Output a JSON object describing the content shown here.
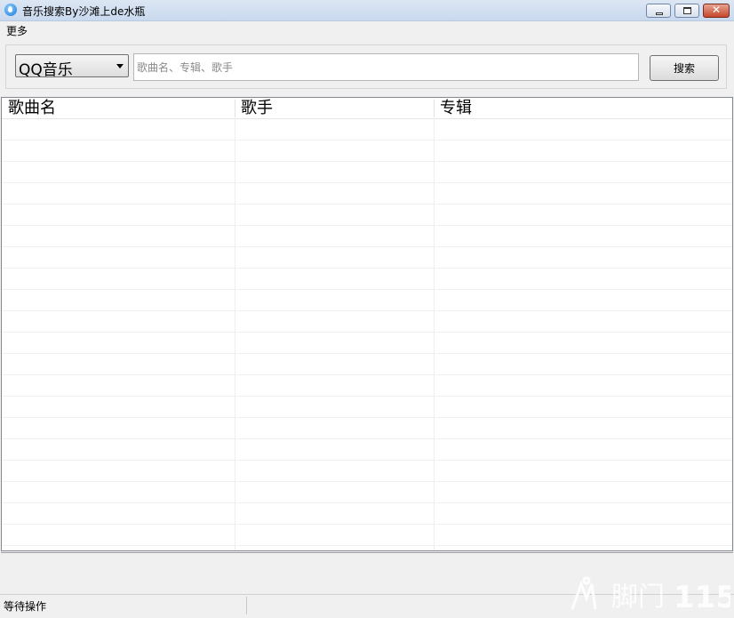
{
  "window": {
    "title": "音乐搜索By沙滩上de水瓶",
    "close_glyph": "✕"
  },
  "menu": {
    "items": [
      "更多"
    ]
  },
  "search": {
    "source": "QQ音乐",
    "query": "",
    "placeholder": "歌曲名、专辑、歌手",
    "button_label": "搜索"
  },
  "table": {
    "columns": [
      "歌曲名",
      "歌手",
      "专辑"
    ],
    "rows": []
  },
  "status": {
    "text": "等待操作"
  },
  "watermark": {
    "text": "脚门",
    "number": "115"
  }
}
